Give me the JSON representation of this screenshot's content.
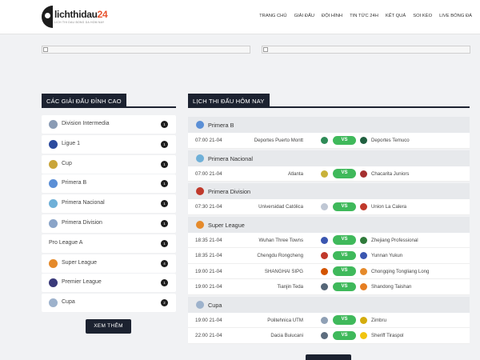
{
  "header": {
    "logo_text": "lichthidau",
    "logo_num": "24",
    "logo_sub": "LICH THI DAU BONG DA HOM NAY",
    "nav": [
      "TRANG CHỦ",
      "GIẢI ĐẤU",
      "ĐỘI HÌNH",
      "TIN TỨC 24H",
      "KẾT QUẢ",
      "SOI KÈO",
      "LIVE BÓNG ĐÁ"
    ]
  },
  "sidebar": {
    "title": "CÁC GIẢI ĐẤU ĐỈNH CAO",
    "leagues": [
      {
        "name": "Division Intermedia",
        "count": "1",
        "color": "#8a9bb4"
      },
      {
        "name": "Ligue 1",
        "count": "1",
        "color": "#2b4a9e"
      },
      {
        "name": "Cup",
        "count": "1",
        "color": "#c9a53a"
      },
      {
        "name": "Primera B",
        "count": "1",
        "color": "#5b8fd6"
      },
      {
        "name": "Primera Nacional",
        "count": "1",
        "color": "#6fb0d8"
      },
      {
        "name": "Primera Division",
        "count": "1",
        "color": "#8aa4c8"
      },
      {
        "name": "Pro League A",
        "count": "1",
        "color": ""
      },
      {
        "name": "Super League",
        "count": "4",
        "color": "#e58a2b"
      },
      {
        "name": "Premier League",
        "count": "1",
        "color": "#3a3a7a"
      },
      {
        "name": "Cupa",
        "count": "2",
        "color": "#9db2cc"
      }
    ],
    "more_label": "XEM THÊM"
  },
  "schedule": {
    "title": "LỊCH THI ĐẤU HÔM NAY",
    "vs_label": "VS",
    "groups": [
      {
        "name": "Primera B",
        "color": "#5b8fd6",
        "matches": [
          {
            "time": "07:00 21-04",
            "home": "Deportes Puerto Montt",
            "away": "Deportes Temuco",
            "hcolor": "#2e8b57",
            "acolor": "#1f5f3f"
          }
        ]
      },
      {
        "name": "Primera Nacional",
        "color": "#6fb0d8",
        "matches": [
          {
            "time": "07:00 21-04",
            "home": "Atlanta",
            "away": "Chacarita Juniors",
            "hcolor": "#c9b23a",
            "acolor": "#a53030"
          }
        ]
      },
      {
        "name": "Primera Division",
        "color": "#c0392b",
        "matches": [
          {
            "time": "07:30 21-04",
            "home": "Universidad Católica",
            "away": "Union La Calera",
            "hcolor": "#bfc7d4",
            "acolor": "#c0392b"
          }
        ]
      },
      {
        "name": "Super League",
        "color": "#e58a2b",
        "matches": [
          {
            "time": "18:35 21-04",
            "home": "Wuhan Three Towns",
            "away": "Zhejiang Professional",
            "hcolor": "#3a56b0",
            "acolor": "#2f7a3a"
          },
          {
            "time": "18:35 21-04",
            "home": "Chengdu Rongcheng",
            "away": "Yunnan Yukun",
            "hcolor": "#c0392b",
            "acolor": "#3a56b0"
          },
          {
            "time": "19:00 21-04",
            "home": "SHANGHAI SIPG",
            "away": "Chongqing Tongliang Long",
            "hcolor": "#d35400",
            "acolor": "#e58a2b"
          },
          {
            "time": "19:00 21-04",
            "home": "Tianjin Teda",
            "away": "Shandong Taishan",
            "hcolor": "#556677",
            "acolor": "#e67e22"
          }
        ]
      },
      {
        "name": "Cupa",
        "color": "#9db2cc",
        "matches": [
          {
            "time": "19:00 21-04",
            "home": "Politehnica UTM",
            "away": "Zimbru",
            "hcolor": "#8fa0b5",
            "acolor": "#d4ac0d"
          },
          {
            "time": "22:00 21-04",
            "home": "Dacia Buiucani",
            "away": "Sheriff Tiraspol",
            "hcolor": "#5d6d7e",
            "acolor": "#f1c40f"
          }
        ]
      }
    ]
  }
}
